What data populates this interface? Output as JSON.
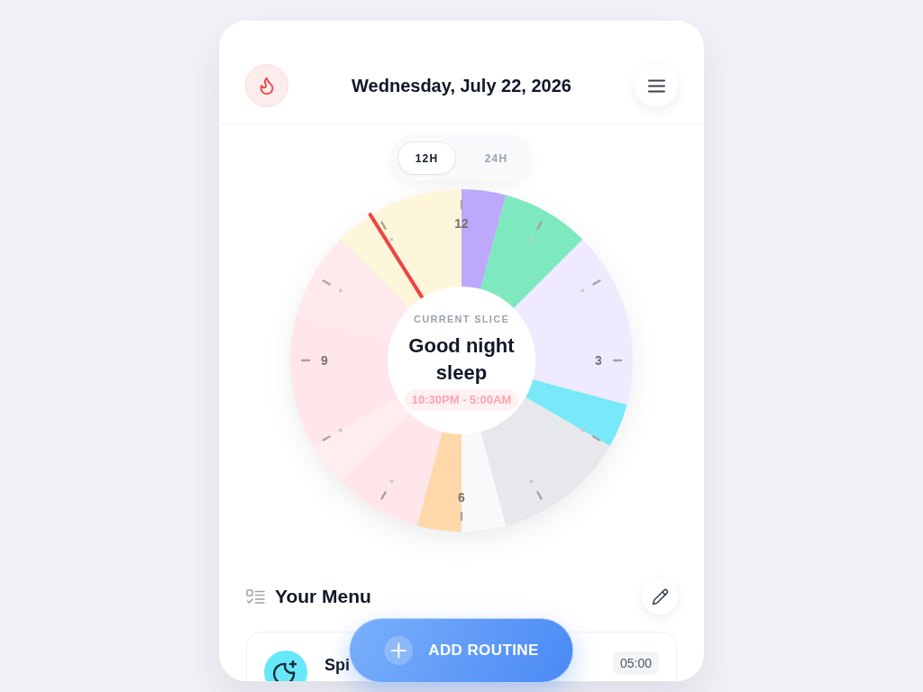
{
  "header": {
    "title": "Wednesday, July 22, 2026"
  },
  "format_toggle": [
    {
      "label": "12H",
      "selected": true
    },
    {
      "label": "24H",
      "selected": false
    }
  ],
  "clock": {
    "hour_labels": [
      "12",
      "3",
      "6",
      "9"
    ],
    "chart_data": {
      "type": "donut",
      "values": [
        4.17,
        8.33,
        16.67,
        4.17,
        12.5,
        4.17,
        4.17,
        8.33,
        4.17,
        12.5,
        8.33,
        12.5
      ],
      "colors": [
        "#bca9fc",
        "#7ee8be",
        "#efeafe",
        "#77e9f9",
        "#e7e8eb",
        "#f9f9fb",
        "#fed8a8",
        "#ffe6eb",
        "#ffedf0",
        "#ffe6ea",
        "#ffe9ed",
        "#fef6da"
      ]
    },
    "current_time_hand": {
      "level": 0.911
    },
    "current_slice": {
      "caption": "CURRENT SLICE",
      "title": "Good night sleep",
      "time_range": "10:30PM - 5:00AM"
    }
  },
  "menu": {
    "title": "Your Menu",
    "routines": [
      {
        "name": "Spi",
        "time": "05:00",
        "color": "#67e8f9"
      }
    ]
  },
  "add_button": {
    "label": "ADD ROUTINE"
  }
}
